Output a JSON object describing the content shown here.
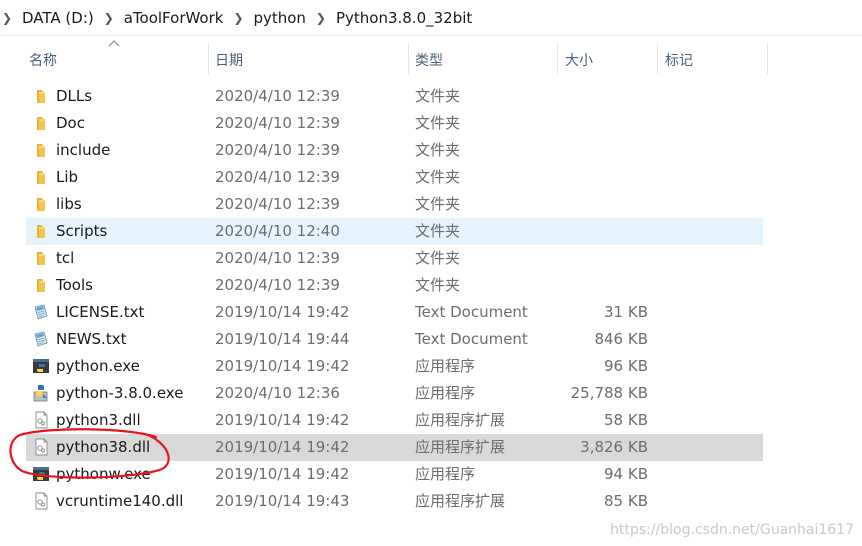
{
  "breadcrumb": {
    "items": [
      "DATA (D:)",
      "aToolForWork",
      "python",
      "Python3.8.0_32bit"
    ]
  },
  "columns": {
    "name": "名称",
    "date": "日期",
    "type": "类型",
    "size": "大小",
    "tag": "标记"
  },
  "files": [
    {
      "name": "DLLs",
      "date": "2020/4/10 12:39",
      "type": "文件夹",
      "size": "",
      "icon": "folder-icon"
    },
    {
      "name": "Doc",
      "date": "2020/4/10 12:39",
      "type": "文件夹",
      "size": "",
      "icon": "folder-icon"
    },
    {
      "name": "include",
      "date": "2020/4/10 12:39",
      "type": "文件夹",
      "size": "",
      "icon": "folder-icon"
    },
    {
      "name": "Lib",
      "date": "2020/4/10 12:39",
      "type": "文件夹",
      "size": "",
      "icon": "folder-icon"
    },
    {
      "name": "libs",
      "date": "2020/4/10 12:39",
      "type": "文件夹",
      "size": "",
      "icon": "folder-icon"
    },
    {
      "name": "Scripts",
      "date": "2020/4/10 12:40",
      "type": "文件夹",
      "size": "",
      "icon": "folder-icon",
      "state": "selected"
    },
    {
      "name": "tcl",
      "date": "2020/4/10 12:39",
      "type": "文件夹",
      "size": "",
      "icon": "folder-icon"
    },
    {
      "name": "Tools",
      "date": "2020/4/10 12:39",
      "type": "文件夹",
      "size": "",
      "icon": "folder-icon"
    },
    {
      "name": "LICENSE.txt",
      "date": "2019/10/14 19:42",
      "type": "Text Document",
      "size": "31 KB",
      "icon": "text-document-icon"
    },
    {
      "name": "NEWS.txt",
      "date": "2019/10/14 19:44",
      "type": "Text Document",
      "size": "846 KB",
      "icon": "text-document-icon"
    },
    {
      "name": "python.exe",
      "date": "2019/10/14 19:42",
      "type": "应用程序",
      "size": "96 KB",
      "icon": "python-exe-icon"
    },
    {
      "name": "python-3.8.0.exe",
      "date": "2020/4/10 12:36",
      "type": "应用程序",
      "size": "25,788 KB",
      "icon": "installer-exe-icon"
    },
    {
      "name": "python3.dll",
      "date": "2019/10/14 19:42",
      "type": "应用程序扩展",
      "size": "58 KB",
      "icon": "dll-icon"
    },
    {
      "name": "python38.dll",
      "date": "2019/10/14 19:42",
      "type": "应用程序扩展",
      "size": "3,826 KB",
      "icon": "dll-icon",
      "state": "highlight"
    },
    {
      "name": "pythonw.exe",
      "date": "2019/10/14 19:42",
      "type": "应用程序",
      "size": "94 KB",
      "icon": "python-exe-icon"
    },
    {
      "name": "vcruntime140.dll",
      "date": "2019/10/14 19:43",
      "type": "应用程序扩展",
      "size": "85 KB",
      "icon": "dll-icon"
    }
  ],
  "watermark": "https://blog.csdn.net/Guanhai1617",
  "colors": {
    "selected_row": "#e5f3ff",
    "highlight_row": "#d9d9d9",
    "annotation": "#e8141b",
    "folder": "#f3c54b"
  }
}
